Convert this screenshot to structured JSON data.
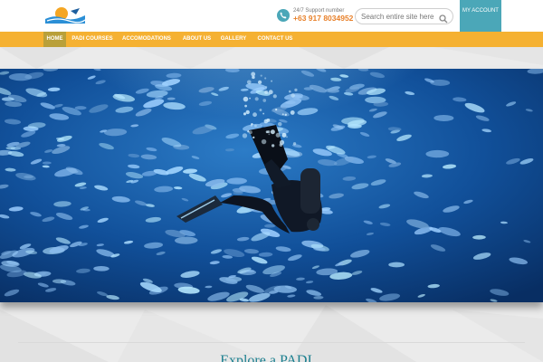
{
  "header": {
    "logo": {
      "icon": "dive-shop-logo-icon",
      "accent": "#f5a623",
      "water": "#2b8fd6"
    },
    "support": {
      "icon": "phone-icon",
      "label": "24/7 Support number",
      "number": "+63 917 8034952"
    },
    "search": {
      "placeholder": "Search entire site here",
      "value": "",
      "icon": "search-icon"
    },
    "account": {
      "label": "MY ACCOUNT"
    }
  },
  "nav": {
    "items": [
      {
        "label": "HOME",
        "active": true
      },
      {
        "label": "PADI COURSES",
        "active": false
      },
      {
        "label": "ACCOMODATIONS",
        "active": false
      },
      {
        "label": "ABOUT US",
        "active": false
      },
      {
        "label": "GALLERY",
        "active": false
      },
      {
        "label": "CONTACT US",
        "active": false
      }
    ]
  },
  "hero": {
    "alt": "scuba diver swimming beside school of fish"
  },
  "section": {
    "heading": "Explore a PADI..."
  },
  "colors": {
    "accent_orange": "#f5b132",
    "active_nav": "#b9a03a",
    "teal": "#4ba7b8",
    "number_orange": "#e8812b",
    "heading_teal": "#1c7f8f"
  }
}
